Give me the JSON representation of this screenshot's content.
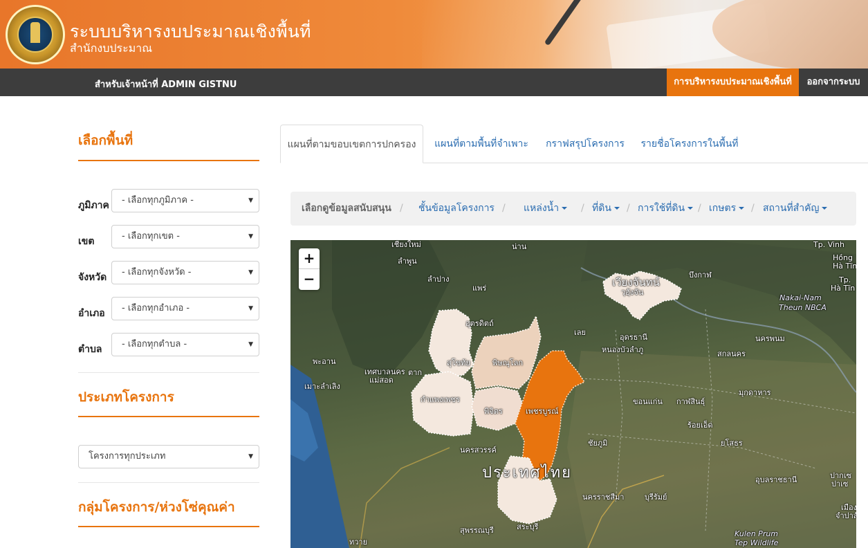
{
  "header": {
    "title": "ระบบบริหารงบประมาณเชิงพื้นที่",
    "subtitle": "สำนักงบประมาณ"
  },
  "navbar": {
    "user_text": "สำหรับเจ้าหน้าที่ ADMIN GISTNU",
    "items": [
      {
        "label": "การบริหารงบประมาณเชิงพื้นที่",
        "active": true
      },
      {
        "label": "ออกจากระบบ",
        "active": false
      }
    ]
  },
  "sidebar": {
    "area_heading": "เลือกพื้นที่",
    "filters": [
      {
        "label": "ภูมิภาค",
        "value": "- เลือกทุกภูมิภาค -"
      },
      {
        "label": "เขต",
        "value": "- เลือกทุกเขต -"
      },
      {
        "label": "จังหวัด",
        "value": "- เลือกทุกจังหวัด -"
      },
      {
        "label": "อำเภอ",
        "value": "- เลือกทุกอำเภอ -"
      },
      {
        "label": "ตำบล",
        "value": "- เลือกทุกตำบล -"
      }
    ],
    "project_type_heading": "ประเภทโครงการ",
    "project_type_value": "โครงการทุกประเภท",
    "group_heading": "กลุ่มโครงการ/ห่วงโซ่คุณค่า"
  },
  "tabs": [
    {
      "label": "แผนที่ตามขอบเขตการปกครอง",
      "active": true
    },
    {
      "label": "แผนที่ตามพื้นที่จำเพาะ",
      "active": false
    },
    {
      "label": "กราฟสรุปโครงการ",
      "active": false
    },
    {
      "label": "รายชื่อโครงการในพื้นที่",
      "active": false
    }
  ],
  "databar": {
    "label": "เลือกดูข้อมูลสนับสนุน",
    "separator": "/",
    "items": [
      {
        "label": "ชั้นข้อมูลโครงการ",
        "dropdown": false
      },
      {
        "label": "แหล่งน้ำ",
        "dropdown": true
      },
      {
        "label": "ที่ดิน",
        "dropdown": true
      },
      {
        "label": "การใช้ที่ดิน",
        "dropdown": true
      },
      {
        "label": "เกษตร",
        "dropdown": true
      },
      {
        "label": "สถานที่สำคัญ",
        "dropdown": true
      }
    ]
  },
  "map": {
    "zoom_in": "+",
    "zoom_out": "−",
    "country_label": "ประเทศไทย",
    "places": [
      "เชียงใหม่",
      "น่าน",
      "ลำพูน",
      "ลำปาง",
      "แพร่",
      "อุตรดิตถ์",
      "เลย",
      "เวียงจันทน์",
      "วฺฮัฺงจัน",
      "บึงกาฬ",
      "อุดรธานี",
      "หนองบัวลำภู",
      "สกลนคร",
      "นครพนม",
      "Nakai-Nam",
      "Theun NBCA",
      "สุโขทัย",
      "พิษณุโลก",
      "กำแพงเพชร",
      "พิจิตร",
      "เพชรบูรณ์",
      "ขอนแก่น",
      "กาฬสินธุ์",
      "มุกดาหาร",
      "ร้อยเอ็ด",
      "ชัยภูมิ",
      "ยโสธร",
      "นครสวรรค์",
      "นครราชสีมา",
      "บุรีรัมย์",
      "อุบลราชธานี",
      "สุพรรณบุรี",
      "สระบุรี",
      "ตาก",
      "เทศบาลนคร",
      "แม่สอด",
      "พะอาน",
      "เมาะลำเลิง",
      "Kulen Prum",
      "Tep Wildlife",
      "Tp. Vinh",
      "Hồng",
      "Hà Tĩnh",
      "Tp.",
      "Hà Tĩn",
      "ปากเซ",
      "ปาเซ",
      "ทวาย",
      "เมือง",
      "จำปาสัก"
    ],
    "highlight_colors": {
      "selected": "#e8740e",
      "light": "#f0ddd0",
      "lighter": "#f4e8de"
    }
  }
}
